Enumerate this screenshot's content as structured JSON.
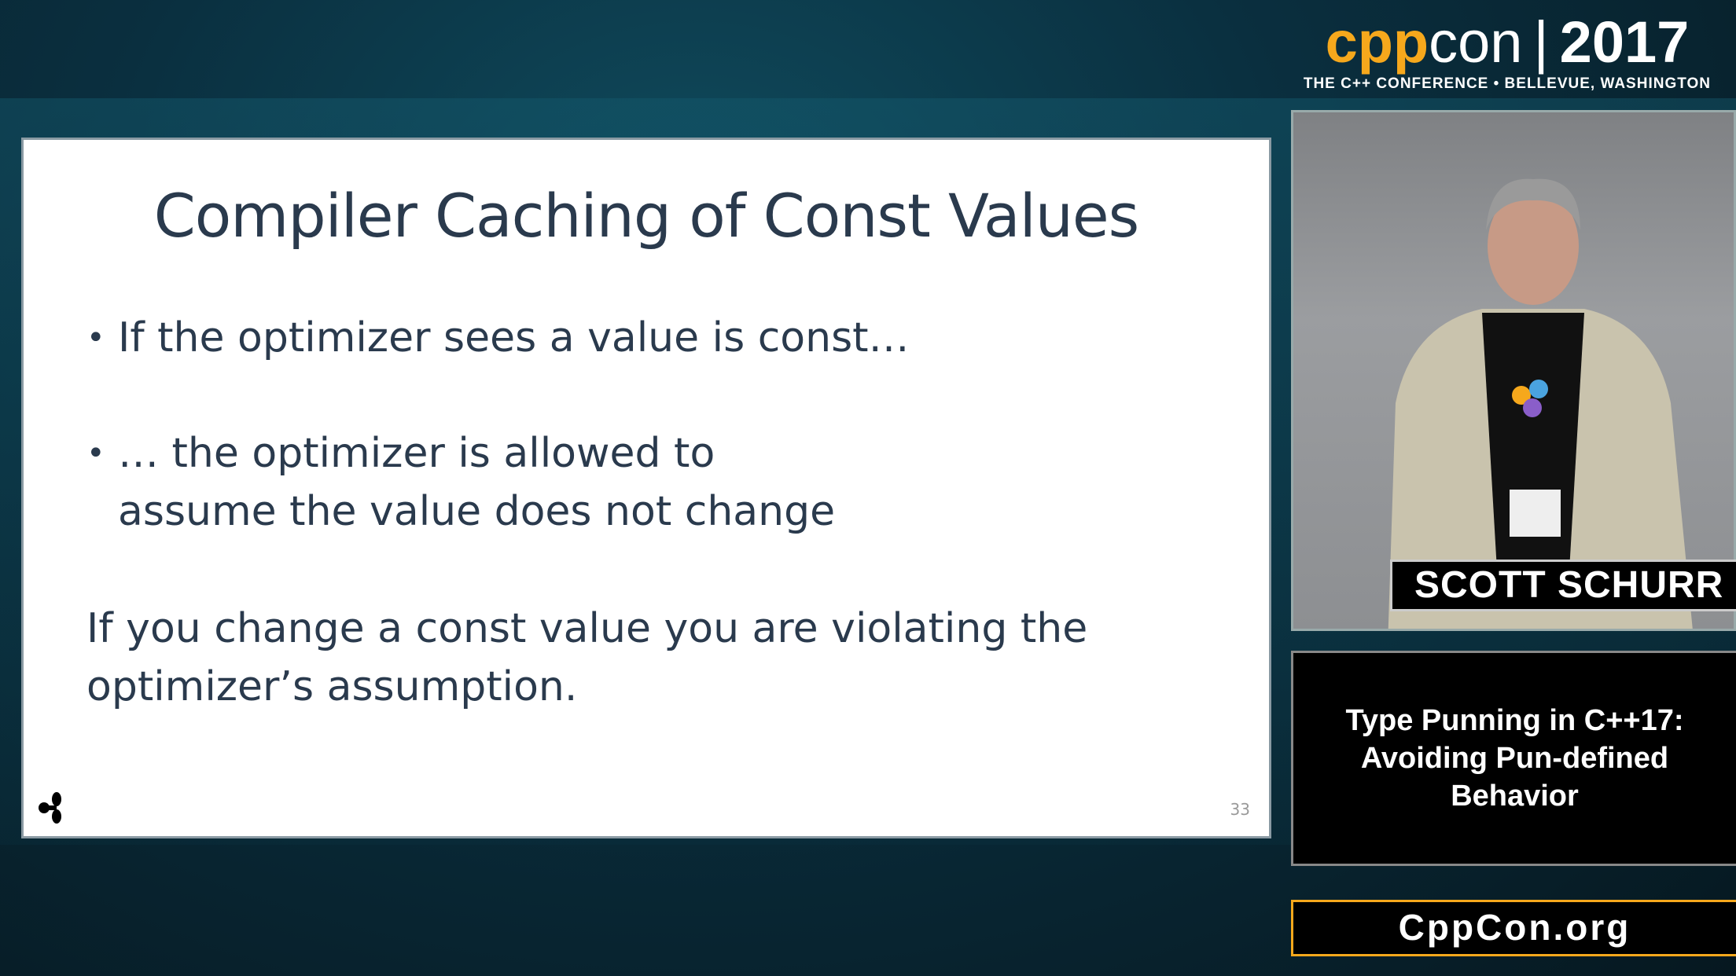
{
  "branding": {
    "logo_cpp": "cpp",
    "logo_con": "con",
    "logo_separator": "|",
    "logo_year": "2017",
    "tagline": "THE C++ CONFERENCE • BELLEVUE, WASHINGTON",
    "accent_color": "#f6a81c"
  },
  "slide": {
    "title": "Compiler Caching of Const Values",
    "bullets": [
      {
        "text": "If the optimizer sees a value is const…"
      },
      {
        "text": "… the optimizer is allowed to assume the value does not change"
      }
    ],
    "paragraph": "If you change a const value you are violating the optimizer’s assumption.",
    "page_number": "33",
    "logo_icon": "four-leaf-logo-icon"
  },
  "speaker": {
    "name": "SCOTT SCHURR"
  },
  "talk": {
    "title": "Type Punning in C++17: Avoiding Pun-defined Behavior"
  },
  "footer": {
    "site": "CppCon.org"
  }
}
